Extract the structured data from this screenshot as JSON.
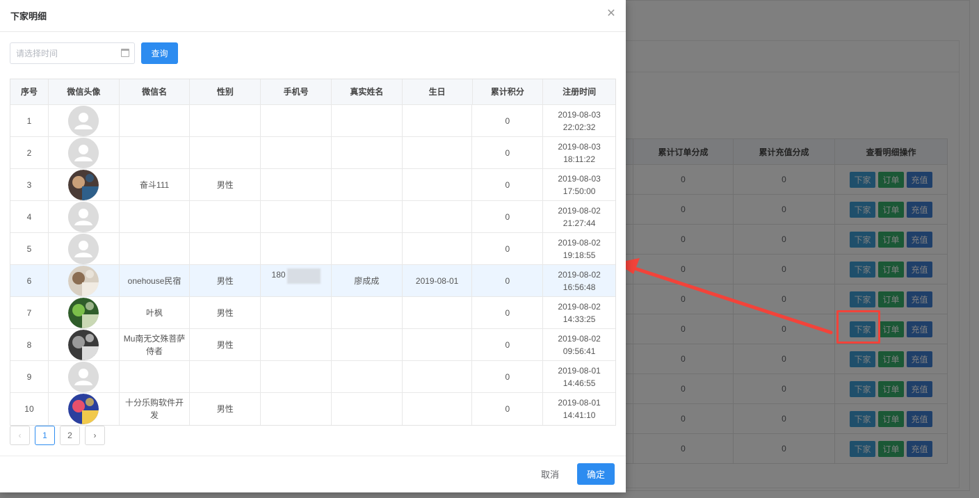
{
  "dialog": {
    "title": "下家明细",
    "date_placeholder": "请选择时间",
    "query_label": "查询",
    "cancel_label": "取消",
    "confirm_label": "确定",
    "close_icon": "close-icon"
  },
  "table": {
    "headers": [
      "序号",
      "微信头像",
      "微信名",
      "性别",
      "手机号",
      "真实姓名",
      "生日",
      "累计积分",
      "注册时间"
    ],
    "rows": [
      {
        "no": "1",
        "avatar": "default",
        "name": "",
        "gender": "",
        "phone": "",
        "real_name": "",
        "birthday": "",
        "points": "0",
        "reg_date": "2019-08-03",
        "reg_time": "22:02:32"
      },
      {
        "no": "2",
        "avatar": "default",
        "name": "",
        "gender": "",
        "phone": "",
        "real_name": "",
        "birthday": "",
        "points": "0",
        "reg_date": "2019-08-03",
        "reg_time": "18:11:22"
      },
      {
        "no": "3",
        "avatar": "photo",
        "name": "奋斗111",
        "gender": "男性",
        "phone": "",
        "real_name": "",
        "birthday": "",
        "points": "0",
        "reg_date": "2019-08-03",
        "reg_time": "17:50:00"
      },
      {
        "no": "4",
        "avatar": "default",
        "name": "",
        "gender": "",
        "phone": "",
        "real_name": "",
        "birthday": "",
        "points": "0",
        "reg_date": "2019-08-02",
        "reg_time": "21:27:44"
      },
      {
        "no": "5",
        "avatar": "default",
        "name": "",
        "gender": "",
        "phone": "",
        "real_name": "",
        "birthday": "",
        "points": "0",
        "reg_date": "2019-08-02",
        "reg_time": "19:18:55"
      },
      {
        "no": "6",
        "avatar": "photo",
        "name": "onehouse民宿",
        "gender": "男性",
        "phone": "180",
        "real_name": "廖成成",
        "birthday": "2019-08-01",
        "points": "0",
        "reg_date": "2019-08-02",
        "reg_time": "16:56:48"
      },
      {
        "no": "7",
        "avatar": "photo",
        "name": "叶枫",
        "gender": "男性",
        "phone": "",
        "real_name": "",
        "birthday": "",
        "points": "0",
        "reg_date": "2019-08-02",
        "reg_time": "14:33:25"
      },
      {
        "no": "8",
        "avatar": "photo",
        "name": "Mu南无文殊菩萨侍者",
        "gender": "男性",
        "phone": "",
        "real_name": "",
        "birthday": "",
        "points": "0",
        "reg_date": "2019-08-02",
        "reg_time": "09:56:41"
      },
      {
        "no": "9",
        "avatar": "default",
        "name": "",
        "gender": "",
        "phone": "",
        "real_name": "",
        "birthday": "",
        "points": "0",
        "reg_date": "2019-08-01",
        "reg_time": "14:46:55"
      },
      {
        "no": "10",
        "avatar": "photo",
        "name": "十分乐购软件开发",
        "gender": "男性",
        "phone": "",
        "real_name": "",
        "birthday": "",
        "points": "0",
        "reg_date": "2019-08-01",
        "reg_time": "14:41:10"
      }
    ],
    "selected_row": "6"
  },
  "pagination": {
    "prev_icon": "chevron-left-icon",
    "next_icon": "chevron-right-icon",
    "pages": [
      "1",
      "2"
    ],
    "current": "1"
  },
  "background": {
    "headers": [
      "累计订单分成",
      "累计充值分成",
      "查看明细操作"
    ],
    "rows": [
      {
        "order": "0",
        "recharge": "0"
      },
      {
        "order": "0",
        "recharge": "0"
      },
      {
        "order": "0",
        "recharge": "0"
      },
      {
        "order": "0",
        "recharge": "0"
      },
      {
        "order": "0",
        "recharge": "0"
      },
      {
        "order": "0",
        "recharge": "0"
      },
      {
        "order": "0",
        "recharge": "0"
      },
      {
        "order": "0",
        "recharge": "0"
      },
      {
        "order": "0",
        "recharge": "0"
      },
      {
        "order": "0",
        "recharge": "0"
      }
    ],
    "btn_downline": "下家",
    "btn_order": "订单",
    "btn_recharge": "充值"
  },
  "colors": {
    "primary": "#2d8cf0",
    "annotation": "#f2433a",
    "btn_blue": "#3e9ed6",
    "btn_green": "#36b06c",
    "btn_deep": "#3f7ed3"
  }
}
